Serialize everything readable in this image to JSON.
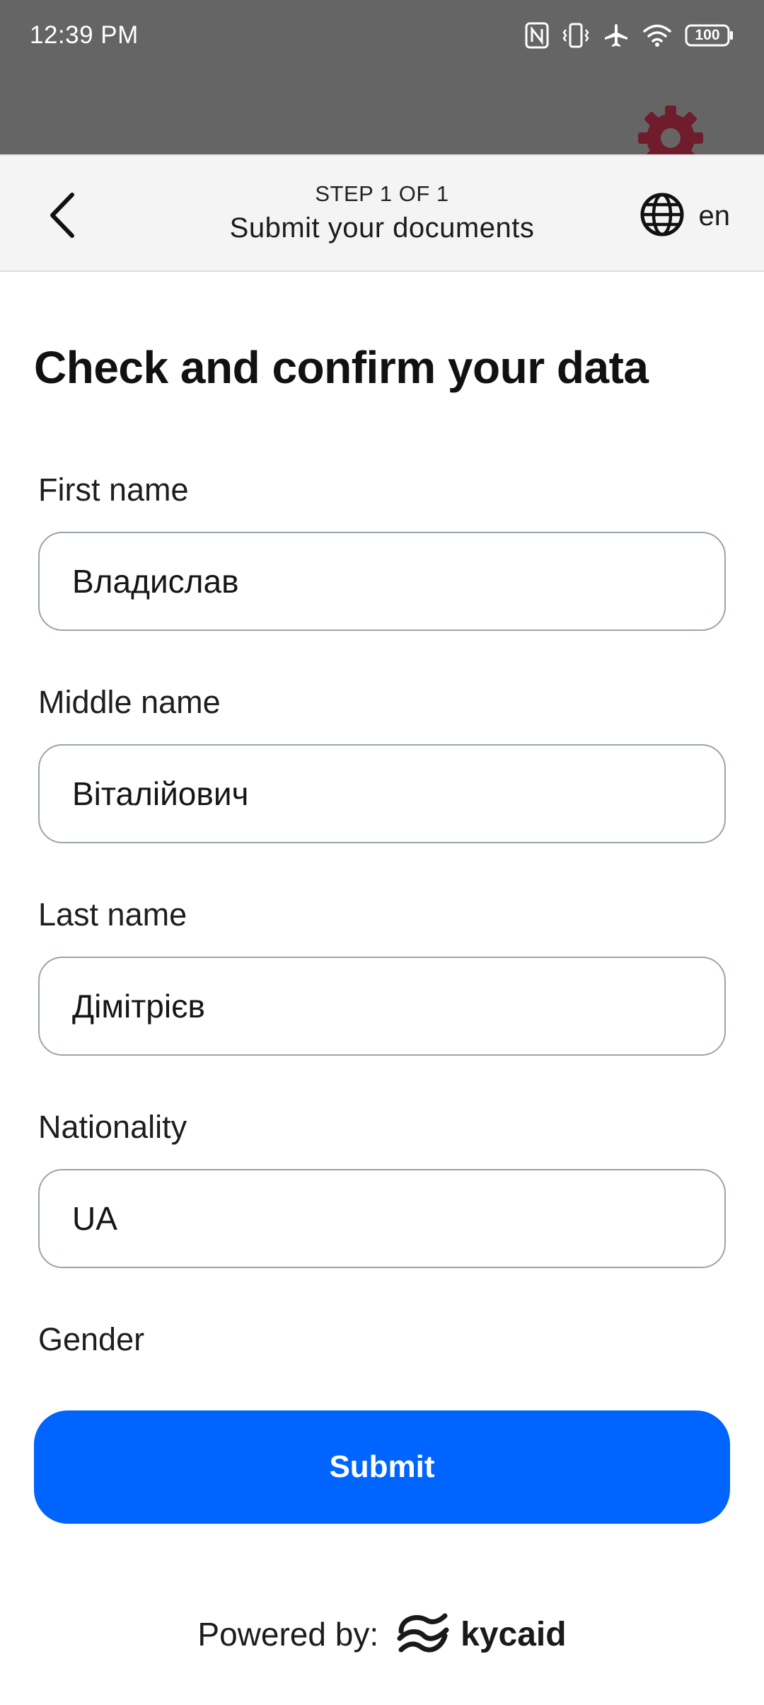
{
  "status_bar": {
    "time": "12:39 PM",
    "battery": "100"
  },
  "header": {
    "step_label": "STEP 1 OF 1",
    "title": "Submit your documents",
    "language": "en"
  },
  "form": {
    "title": "Check and confirm your data",
    "fields": [
      {
        "label": "First name",
        "value": "Владислав"
      },
      {
        "label": "Middle name",
        "value": "Віталійович"
      },
      {
        "label": "Last name",
        "value": "Дімітрієв"
      },
      {
        "label": "Nationality",
        "value": "UA"
      }
    ],
    "gender_label": "Gender",
    "submit_label": "Submit"
  },
  "footer": {
    "powered_by": "Powered by:",
    "brand": "kycaid"
  },
  "colors": {
    "accent": "#0064ff",
    "background_gear": "#6f1c2c"
  }
}
